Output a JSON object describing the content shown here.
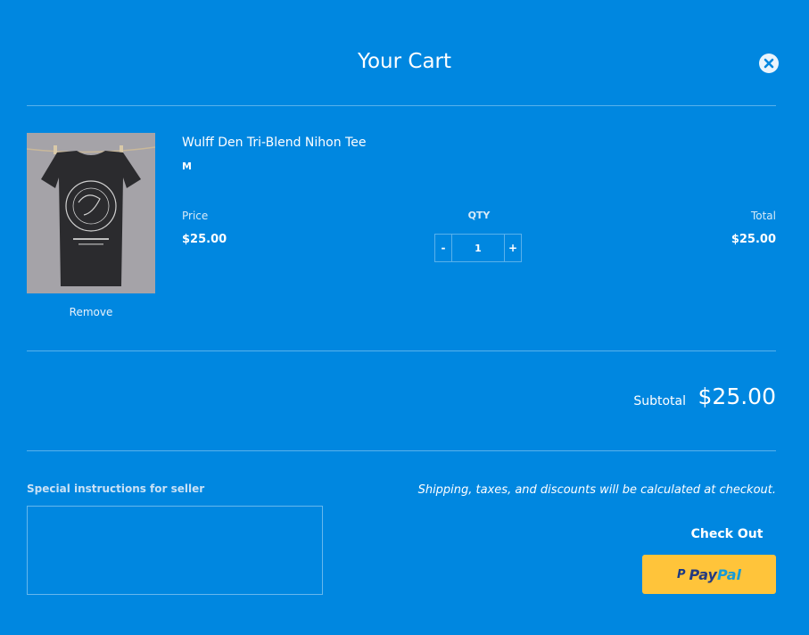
{
  "cart": {
    "title": "Your Cart",
    "close_icon": "close-icon"
  },
  "item": {
    "name": "Wulff Den Tri-Blend Nihon Tee",
    "variant": "M",
    "image_icon": "tshirt-product-image",
    "remove_label": "Remove",
    "price_label": "Price",
    "price": "$25.00",
    "qty_label": "QTY",
    "qty_minus": "-",
    "qty_plus": "+",
    "qty_value": "1",
    "total_label": "Total",
    "total": "$25.00"
  },
  "summary": {
    "subtotal_label": "Subtotal",
    "subtotal_value": "$25.00"
  },
  "notes": {
    "label": "Special instructions for seller",
    "value": ""
  },
  "checkout": {
    "shipping_note": "Shipping, taxes, and discounts will be calculated at checkout.",
    "checkout_label": "Check Out",
    "paypal_icon": "P",
    "paypal_label_dark": "Pay",
    "paypal_label_light": "Pal"
  },
  "colors": {
    "background": "#0087e0",
    "paypal_button": "#ffc43a",
    "paypal_dark": "#253b80",
    "paypal_light": "#179bd7"
  }
}
